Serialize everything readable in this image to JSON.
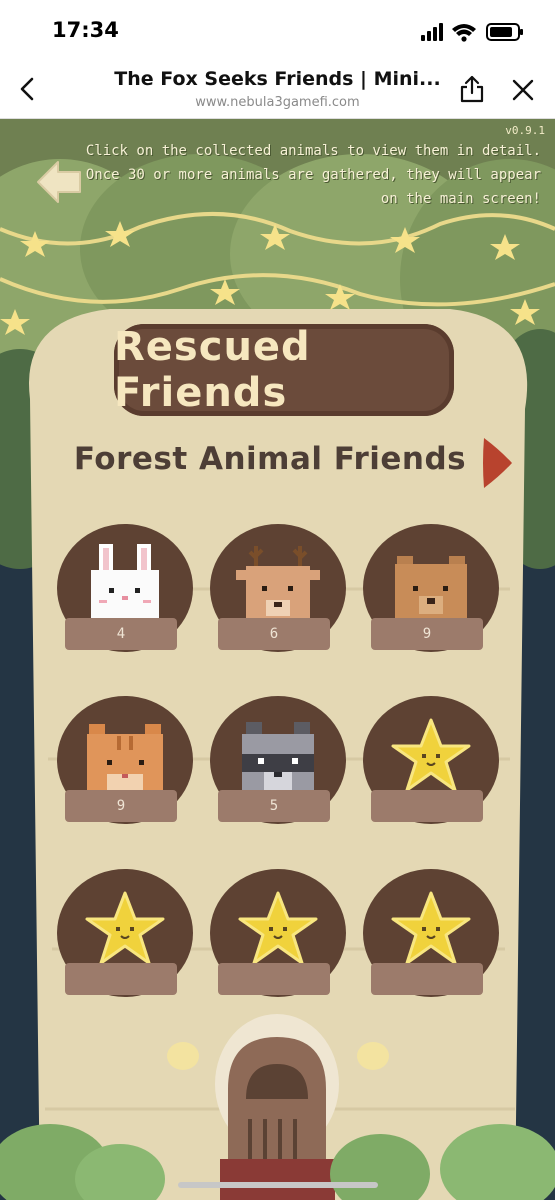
{
  "status_bar": {
    "time": "17:34"
  },
  "browser": {
    "title": "The Fox Seeks Friends | Mini...",
    "url": "www.nebula3gamefi.com"
  },
  "game": {
    "version": "v0.9.1",
    "info_lines": [
      "Click on the collected animals to view them in detail.",
      "Once 30 or more animals are gathered, they will appear",
      "on the main screen!"
    ],
    "title": "Rescued Friends",
    "category": "Forest Animal Friends",
    "animals": [
      {
        "name": "rabbit",
        "count": "4"
      },
      {
        "name": "deer",
        "count": "6"
      },
      {
        "name": "bear",
        "count": "9"
      },
      {
        "name": "cat",
        "count": "9"
      },
      {
        "name": "raccoon",
        "count": "5"
      },
      {
        "name": "locked-star",
        "count": ""
      },
      {
        "name": "locked-star",
        "count": ""
      },
      {
        "name": "locked-star",
        "count": ""
      },
      {
        "name": "locked-star",
        "count": ""
      }
    ]
  },
  "colors": {
    "forest_green": "#6f8051",
    "tree_bark": "#e4d8b4",
    "plaque_brown": "#6b4b3b",
    "card_brown": "#5e4233",
    "count_plate": "#9c7b6b",
    "star_yellow": "#f0d23c",
    "arrow_red": "#b8432e"
  }
}
